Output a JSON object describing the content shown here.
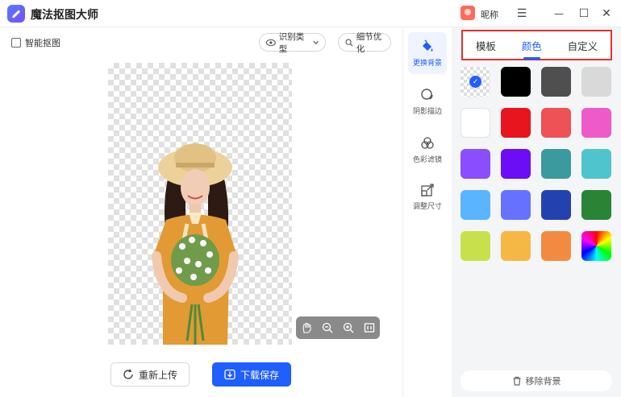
{
  "titlebar": {
    "app_title": "魔法抠图大师",
    "nickname": "昵称",
    "menu_glyph": "☰",
    "minimize_glyph": "—",
    "maximize_glyph": "☐",
    "close_glyph": "✕"
  },
  "toolbar": {
    "smart_cut_label": "智能抠图",
    "recognition_type_label": "识别类型",
    "detail_optimize_label": "细节优化"
  },
  "canvas": {
    "zoom_controls": [
      "pan-icon",
      "zoom-out-icon",
      "zoom-in-icon",
      "fit-icon"
    ]
  },
  "actions": {
    "reupload_label": "重新上传",
    "download_label": "下载保存"
  },
  "tools": [
    {
      "label": "更换背景",
      "icon": "paint-bucket-icon"
    },
    {
      "label": "阴影描边",
      "icon": "shadow-circle-icon"
    },
    {
      "label": "色彩滤镜",
      "icon": "color-filter-icon"
    },
    {
      "label": "调整尺寸",
      "icon": "resize-icon"
    }
  ],
  "panel": {
    "tabs": [
      "模板",
      "颜色",
      "自定义"
    ],
    "active_tab": "颜色",
    "swatch_colors": [
      "transparent",
      "#000000",
      "#4f4f4f",
      "#d9d9d9",
      "#ffffff",
      "#e8141e",
      "#ee5156",
      "#ee5ac8",
      "#8a4dff",
      "#6b0df5",
      "#3a9a9e",
      "#4fc4cc",
      "#5ab4ff",
      "#6672ff",
      "#2342b0",
      "#2a8436",
      "#c9e04d",
      "#f5b845",
      "#f28b41",
      "rainbow"
    ],
    "selected_swatch": 0,
    "remove_bg_label": "移除背景"
  },
  "colors": {
    "accent": "#1f5eff",
    "highlight_box": "#e63030"
  }
}
